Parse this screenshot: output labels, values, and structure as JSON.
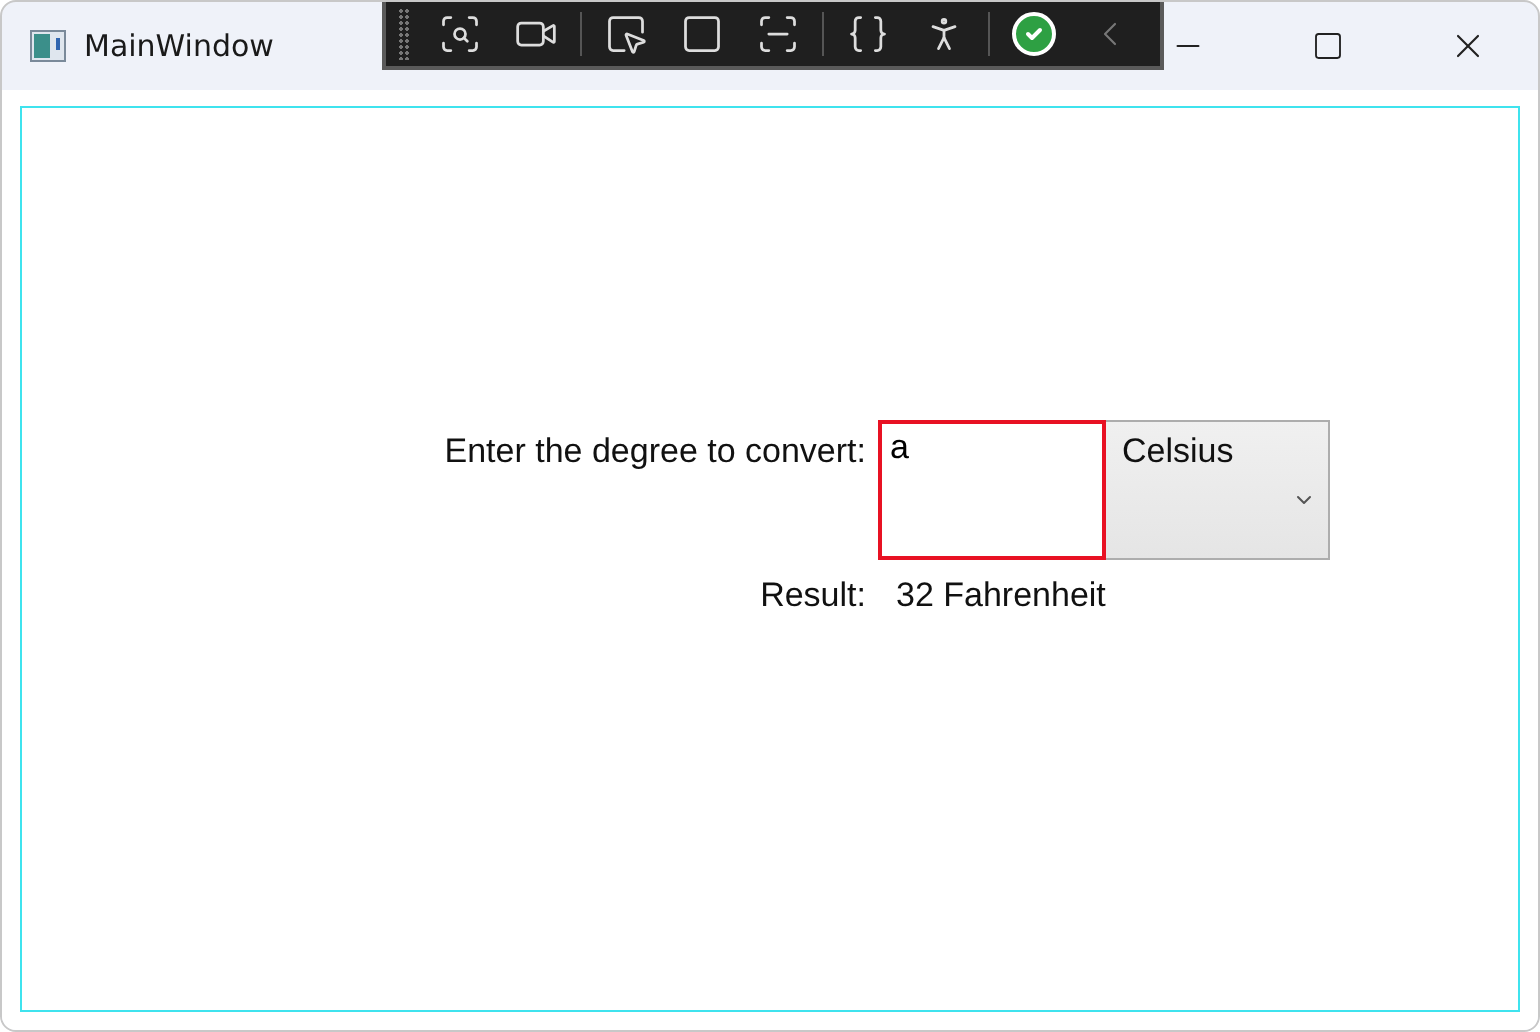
{
  "window": {
    "title": "MainWindow"
  },
  "form": {
    "degree_label": "Enter the degree to convert:",
    "degree_input": {
      "value": "a",
      "invalid": true
    },
    "unit_select": {
      "value": "Celsius"
    },
    "result_label": "Result:",
    "result_value": "32 Fahrenheit"
  }
}
